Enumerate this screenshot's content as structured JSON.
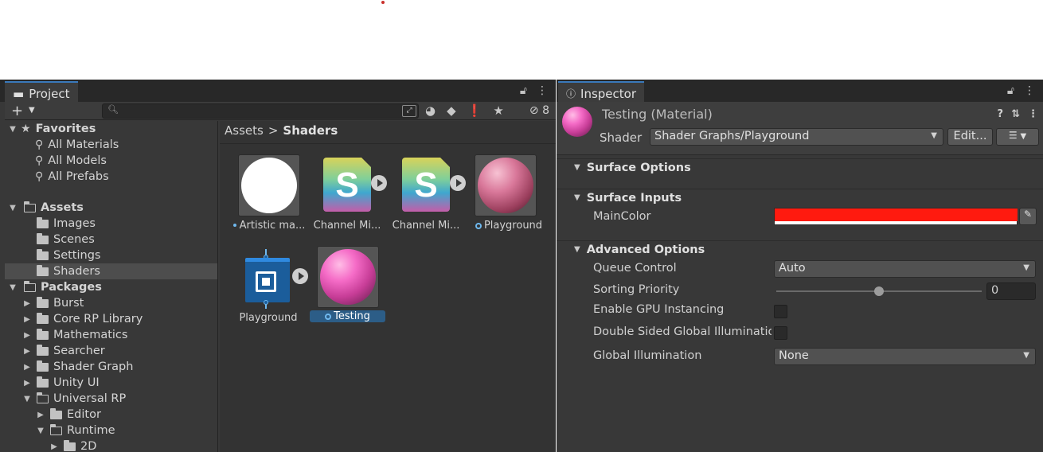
{
  "project": {
    "tab_label": "Project",
    "hidden_count": "8",
    "search": {
      "placeholder": ""
    },
    "tree": {
      "favorites": "Favorites",
      "all_materials": "All Materials",
      "all_models": "All Models",
      "all_prefabs": "All Prefabs",
      "assets": "Assets",
      "images": "Images",
      "scenes": "Scenes",
      "settings": "Settings",
      "shaders": "Shaders",
      "packages": "Packages",
      "burst": "Burst",
      "core_rp": "Core RP Library",
      "mathematics": "Mathematics",
      "searcher": "Searcher",
      "shader_graph": "Shader Graph",
      "unity_ui": "Unity UI",
      "universal_rp": "Universal RP",
      "editor": "Editor",
      "runtime": "Runtime",
      "two_d": "2D"
    },
    "breadcrumb": {
      "root": "Assets",
      "separator": ">",
      "current": "Shaders"
    },
    "assets": [
      {
        "label": "Artistic ma..."
      },
      {
        "label": "Channel Mi..."
      },
      {
        "label": "Channel Mi..."
      },
      {
        "label": "Playground"
      },
      {
        "label": "Playground"
      },
      {
        "label": "Testing"
      }
    ]
  },
  "inspector": {
    "tab_label": "Inspector",
    "title": "Testing (Material)",
    "shader_label": "Shader",
    "shader_value": "Shader Graphs/Playground",
    "edit_button": "Edit...",
    "sections": {
      "surface_options": "Surface Options",
      "surface_inputs": "Surface Inputs",
      "advanced_options": "Advanced Options"
    },
    "props": {
      "main_color": "MainColor",
      "queue_control": "Queue Control",
      "queue_control_value": "Auto",
      "sorting_priority": "Sorting Priority",
      "sorting_priority_value": "0",
      "gpu_instancing": "Enable GPU Instancing",
      "double_sided_gi": "Double Sided Global Illumination",
      "global_illumination": "Global Illumination",
      "global_illumination_value": "None"
    },
    "main_color_hex": "#ff1a0f",
    "sorting_priority_fraction": 0.5
  }
}
